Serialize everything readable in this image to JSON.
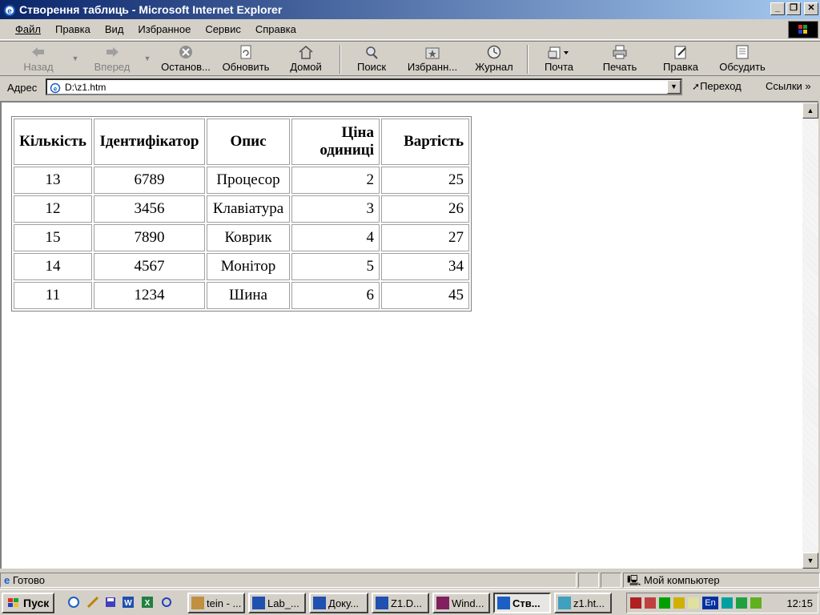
{
  "window": {
    "title": "Створення таблиць - Microsoft Internet Explorer"
  },
  "menu": [
    "Файл",
    "Правка",
    "Вид",
    "Избранное",
    "Сервис",
    "Справка"
  ],
  "toolbar": {
    "back": "Назад",
    "forward": "Вперед",
    "stop": "Останов...",
    "refresh": "Обновить",
    "home": "Домой",
    "search": "Поиск",
    "favorites": "Избранн...",
    "history": "Журнал",
    "mail": "Почта",
    "print": "Печать",
    "edit": "Правка",
    "discuss": "Обсудить"
  },
  "address": {
    "label": "Адрес",
    "value": "D:\\z1.htm",
    "go": "Переход",
    "links": "Ссылки"
  },
  "table": {
    "headers": [
      "Кількість",
      "Ідентифікатор",
      "Опис",
      "Ціна одиниці",
      "Вартість"
    ],
    "rows": [
      [
        "13",
        "6789",
        "Процесор",
        "2",
        "25"
      ],
      [
        "12",
        "3456",
        "Клавіатура",
        "3",
        "26"
      ],
      [
        "15",
        "7890",
        "Коврик",
        "4",
        "27"
      ],
      [
        "14",
        "4567",
        "Монітор",
        "5",
        "34"
      ],
      [
        "11",
        "1234",
        "Шина",
        "6",
        "45"
      ]
    ]
  },
  "status": {
    "text": "Готово",
    "zone": "Мой компьютер"
  },
  "taskbar": {
    "start": "Пуск",
    "tasks": [
      "tein - ...",
      "Lab_...",
      "Доку...",
      "Z1.D...",
      "Wind...",
      "Ств...",
      "z1.ht..."
    ],
    "clock": "12:15",
    "lang": "En"
  }
}
